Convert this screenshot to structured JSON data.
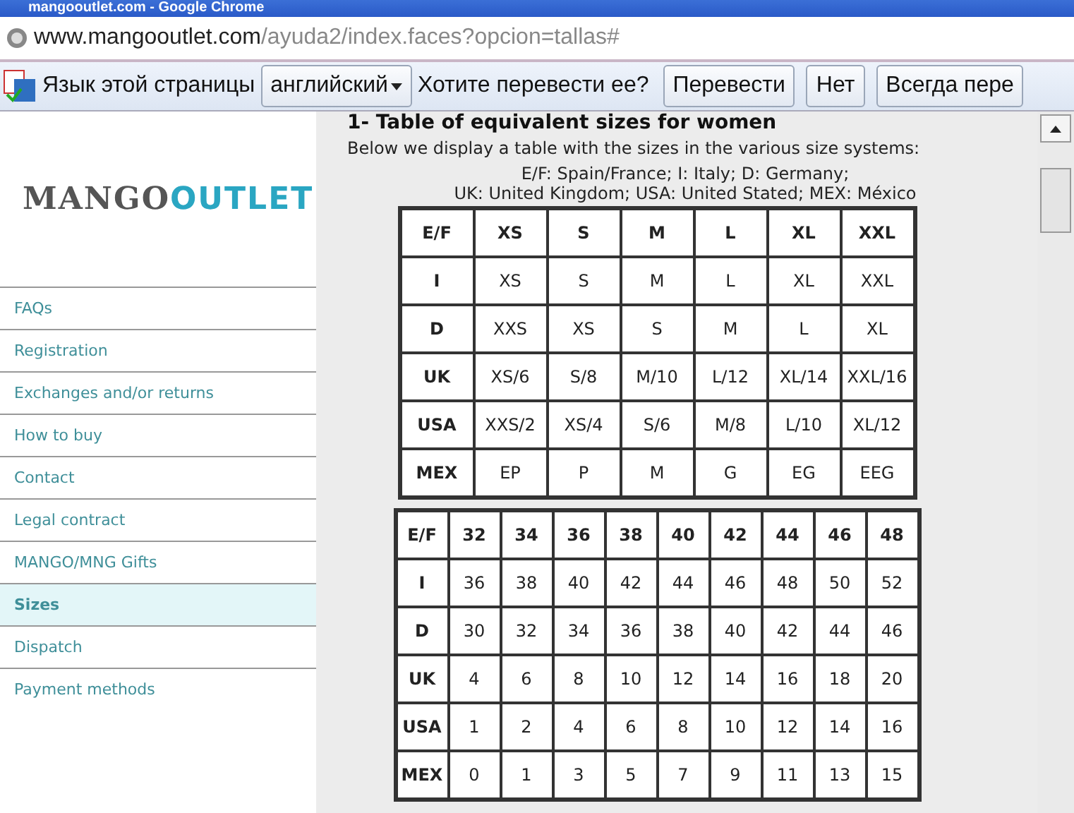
{
  "window": {
    "title": "mangooutlet.com - Google Chrome"
  },
  "address_bar": {
    "domain": "www.mangooutlet.com",
    "path": "/ayuda2/index.faces?opcion=tallas#"
  },
  "translate_bar": {
    "label": "Язык этой страницы",
    "language": "английский",
    "question": "Хотите перевести ее?",
    "buttons": [
      "Перевести",
      "Нет",
      "Всегда пере"
    ]
  },
  "sidebar": {
    "logo": {
      "part_1": "MANGO",
      "part_2": "OUTLET"
    },
    "items": [
      {
        "label": "FAQs",
        "selected": false
      },
      {
        "label": "Registration",
        "selected": false
      },
      {
        "label": "Exchanges and/or returns",
        "selected": false
      },
      {
        "label": "How to buy",
        "selected": false
      },
      {
        "label": "Contact",
        "selected": false
      },
      {
        "label": "Legal contract",
        "selected": false
      },
      {
        "label": "MANGO/MNG Gifts",
        "selected": false
      },
      {
        "label": "Sizes",
        "selected": true
      },
      {
        "label": "Dispatch",
        "selected": false
      },
      {
        "label": "Payment methods",
        "selected": false
      }
    ]
  },
  "content": {
    "heading": "1- Table of equivalent sizes for women",
    "intro": "Below we display a table with the sizes in the various size systems:",
    "legend": [
      "E/F: Spain/France; I: Italy; D: Germany;",
      "UK: United Kingdom; USA: United Stated; MEX: México"
    ],
    "tables": [
      {
        "rows": [
          [
            "E/F",
            "XS",
            "S",
            "M",
            "L",
            "XL",
            "XXL"
          ],
          [
            "I",
            "XS",
            "S",
            "M",
            "L",
            "XL",
            "XXL"
          ],
          [
            "D",
            "XXS",
            "XS",
            "S",
            "M",
            "L",
            "XL"
          ],
          [
            "UK",
            "XS/6",
            "S/8",
            "M/10",
            "L/12",
            "XL/14",
            "XXL/16"
          ],
          [
            "USA",
            "XXS/2",
            "XS/4",
            "S/6",
            "M/8",
            "L/10",
            "XL/12"
          ],
          [
            "MEX",
            "EP",
            "P",
            "M",
            "G",
            "EG",
            "EEG"
          ]
        ]
      },
      {
        "rows": [
          [
            "E/F",
            "32",
            "34",
            "36",
            "38",
            "40",
            "42",
            "44",
            "46",
            "48"
          ],
          [
            "I",
            "36",
            "38",
            "40",
            "42",
            "44",
            "46",
            "48",
            "50",
            "52"
          ],
          [
            "D",
            "30",
            "32",
            "34",
            "36",
            "38",
            "40",
            "42",
            "44",
            "46"
          ],
          [
            "UK",
            "4",
            "6",
            "8",
            "10",
            "12",
            "14",
            "16",
            "18",
            "20"
          ],
          [
            "USA",
            "1",
            "2",
            "4",
            "6",
            "8",
            "10",
            "12",
            "14",
            "16"
          ],
          [
            "MEX",
            "0",
            "1",
            "3",
            "5",
            "7",
            "9",
            "11",
            "13",
            "15"
          ]
        ]
      }
    ]
  }
}
